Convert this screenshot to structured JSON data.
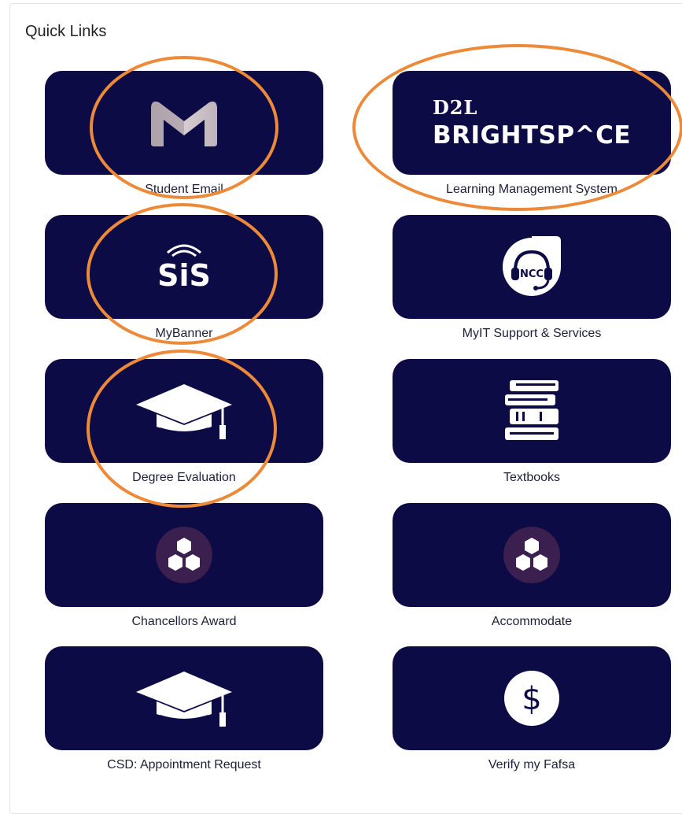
{
  "panel": {
    "title": "Quick Links"
  },
  "links": [
    {
      "label": "Student Email",
      "icon": "gmail-m-icon"
    },
    {
      "label": "Learning Management System",
      "icon": "d2l-brightspace-logo",
      "logo_top": "D2L",
      "logo_bottom": "BRIGHTSP^CE"
    },
    {
      "label": "MyBanner",
      "icon": "sis-logo-icon"
    },
    {
      "label": "MyIT Support & Services",
      "icon": "ncc-headset-icon",
      "icon_text": "NCC"
    },
    {
      "label": "Degree Evaluation",
      "icon": "graduation-cap-icon"
    },
    {
      "label": "Textbooks",
      "icon": "stacked-books-icon"
    },
    {
      "label": "Chancellors Award",
      "icon": "hexagon-cluster-icon"
    },
    {
      "label": "Accommodate",
      "icon": "hexagon-cluster-icon"
    },
    {
      "label": "CSD: Appointment Request",
      "icon": "graduation-cap-icon"
    },
    {
      "label": "Verify my Fafsa",
      "icon": "dollar-coin-icon",
      "icon_text": "$"
    }
  ],
  "colors": {
    "tile_background": "#0d0b45",
    "caption_text": "#1f1f3a",
    "badge_purple": "#3b1f4f",
    "annotation_orange": "#ed8a3a"
  }
}
